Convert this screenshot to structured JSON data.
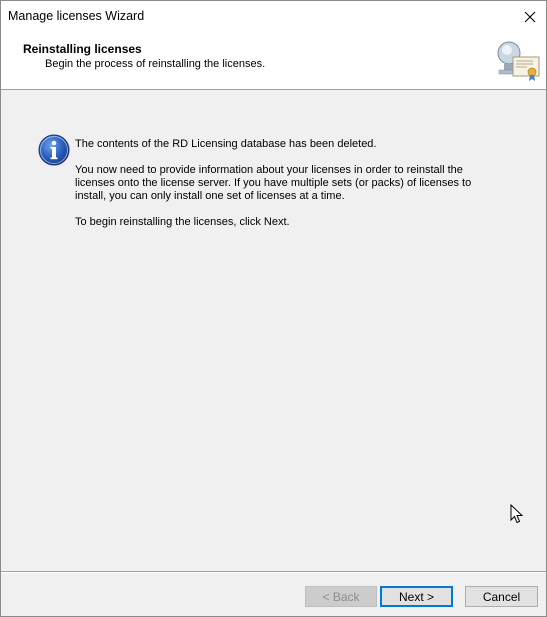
{
  "window": {
    "title": "Manage licenses Wizard"
  },
  "header": {
    "title": "Reinstalling licenses",
    "subtitle": "Begin the process of reinstalling the licenses.",
    "icon": "license-certificate-icon"
  },
  "content": {
    "icon": "info-icon",
    "paragraphs": [
      "The contents of the RD Licensing database has been deleted.",
      "You now need to provide information about your licenses in order to reinstall the licenses onto the license server. If you have multiple sets (or packs) of licenses to install, you can only install one set of licenses at a time.",
      "To begin reinstalling the licenses, click Next."
    ]
  },
  "buttons": {
    "back": "< Back",
    "next": "Next >",
    "cancel": "Cancel"
  },
  "colors": {
    "accent": "#0078d7",
    "background": "#f0f0f0"
  }
}
